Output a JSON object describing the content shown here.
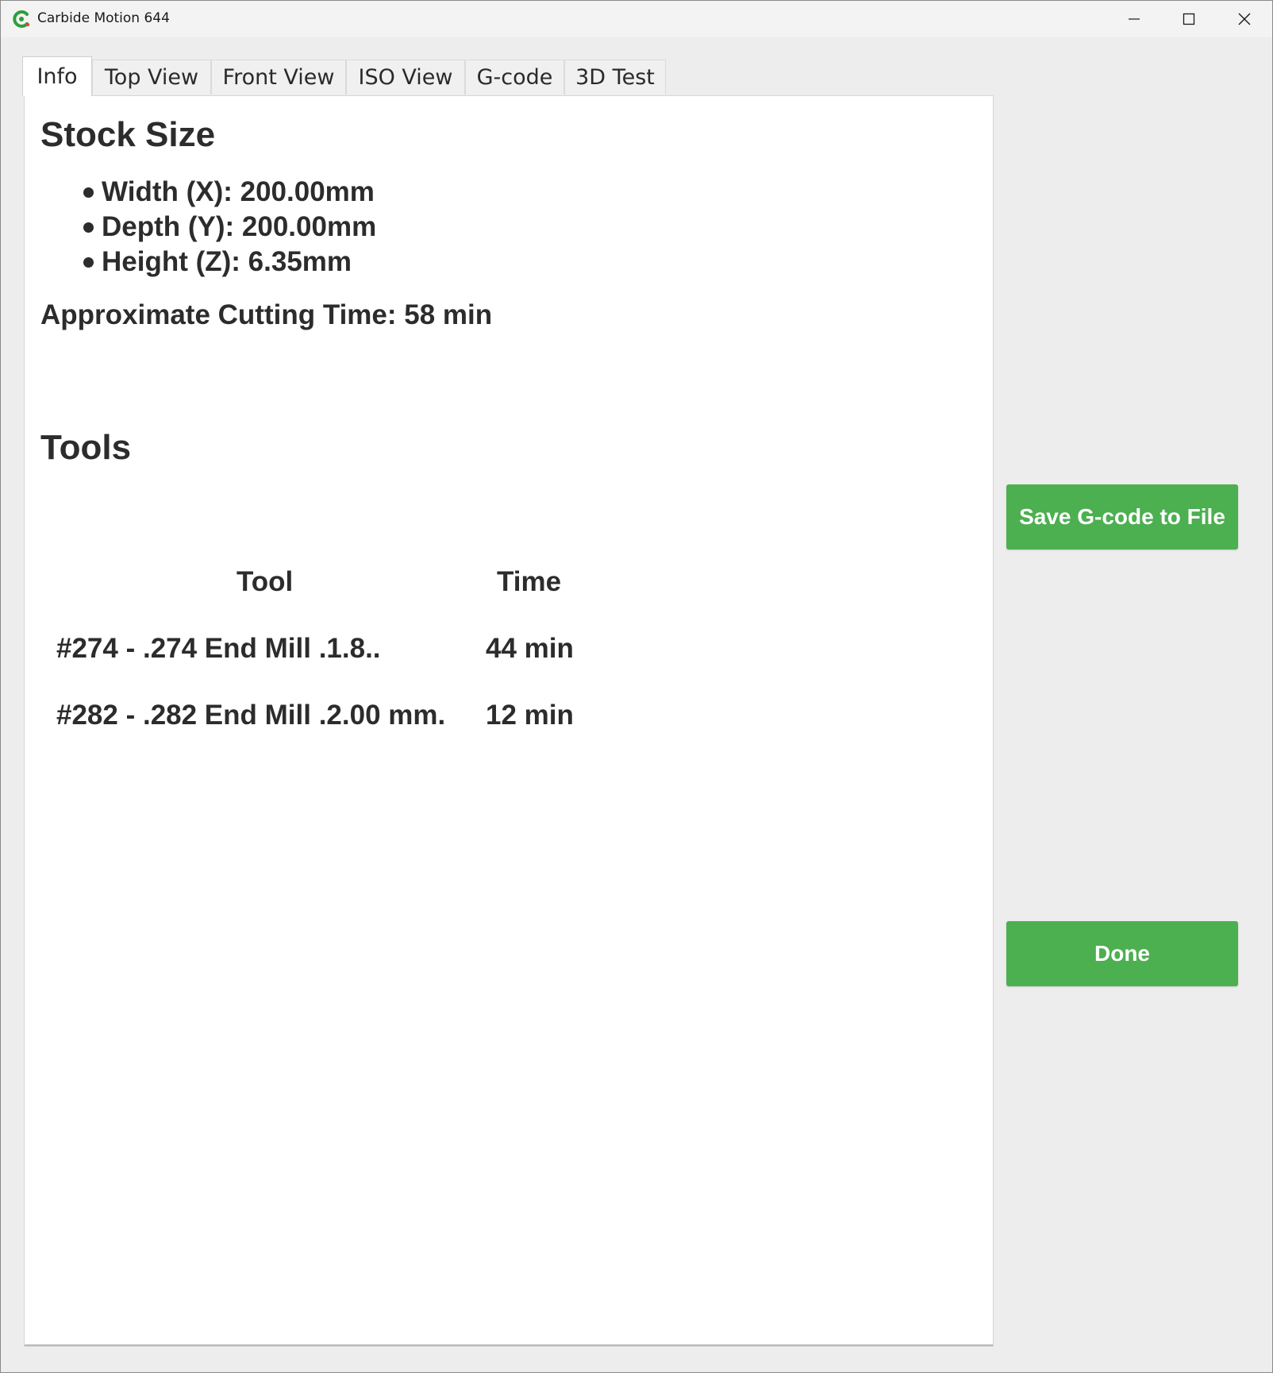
{
  "window": {
    "title": "Carbide Motion 644"
  },
  "tabs": [
    {
      "label": "Info",
      "active": true
    },
    {
      "label": "Top View",
      "active": false
    },
    {
      "label": "Front View",
      "active": false
    },
    {
      "label": "ISO View",
      "active": false
    },
    {
      "label": "G-code",
      "active": false
    },
    {
      "label": "3D Test",
      "active": false
    }
  ],
  "info": {
    "stock_heading": "Stock Size",
    "stock_items": [
      "Width (X): 200.00mm",
      "Depth (Y): 200.00mm",
      "Height (Z): 6.35mm"
    ],
    "cutting_time": "Approximate Cutting Time: 58 min",
    "tools_heading": "Tools",
    "tools_table": {
      "columns": [
        "Tool",
        "Time"
      ],
      "rows": [
        [
          "#274 - .274 End Mill .1.8..",
          "44 min"
        ],
        [
          "#282 - .282 End Mill .2.00 mm.",
          "12 min"
        ]
      ]
    }
  },
  "actions": {
    "save_label": "Save G-code to File",
    "done_label": "Done"
  },
  "colors": {
    "button_green": "#4caf50",
    "icon_green": "#2e9e3a"
  }
}
